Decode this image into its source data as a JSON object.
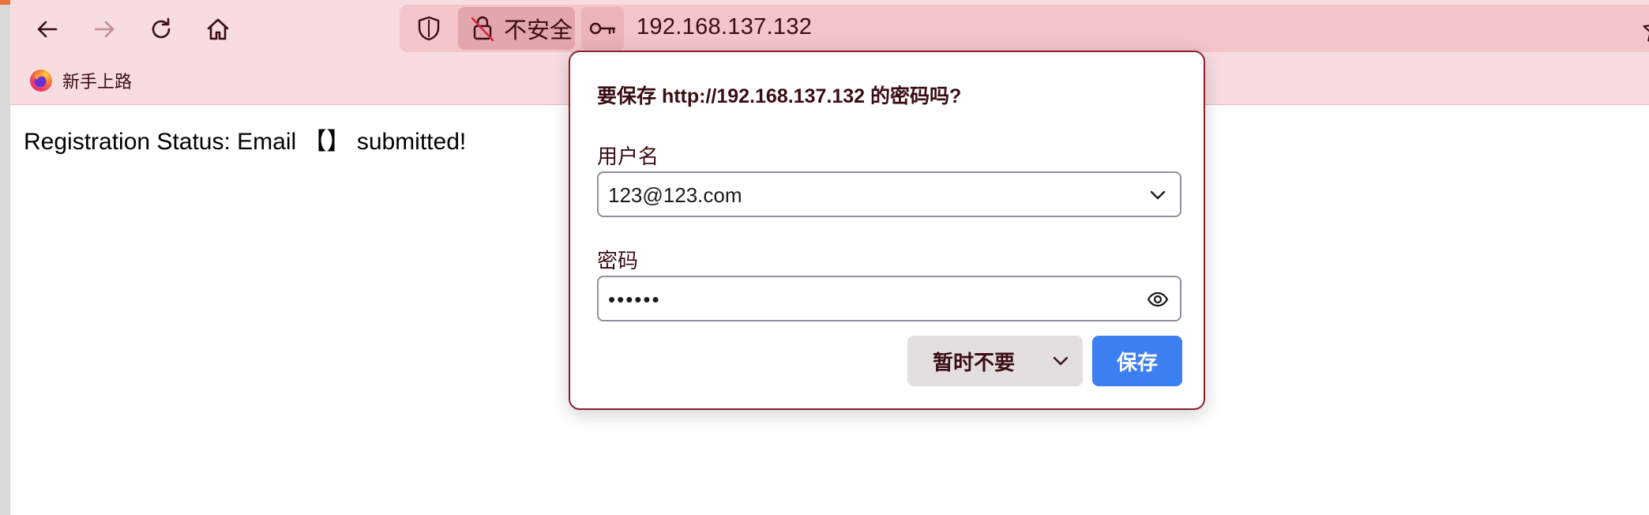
{
  "toolbar": {
    "back_icon": "arrow-left-icon",
    "forward_icon": "arrow-right-icon",
    "reload_icon": "reload-icon",
    "home_icon": "home-icon",
    "url": "192.168.137.132",
    "insecure_label": "不安全",
    "bookmark_label": "新手上路"
  },
  "page": {
    "text": "Registration Status: Email 【】 submitted!"
  },
  "popup": {
    "title": "要保存 http://192.168.137.132 的密码吗?",
    "username_label": "用户名",
    "username_value": "123@123.com",
    "password_label": "密码",
    "password_value": "••••••",
    "later_label": "暂时不要",
    "save_label": "保存"
  },
  "colors": {
    "toolbar_bg": "#f8dde0",
    "urlbar_bg": "#f3c4c9",
    "popup_border": "#8a1f2b",
    "save_button": "#3b7ff0"
  }
}
